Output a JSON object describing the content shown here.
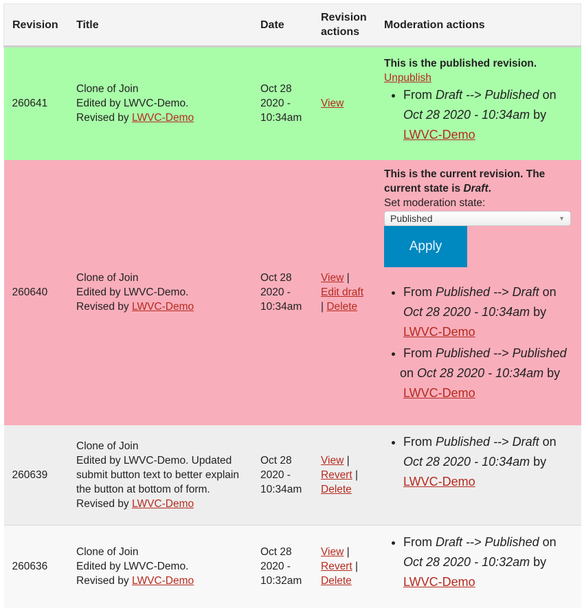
{
  "headers": {
    "revision": "Revision",
    "title": "Title",
    "date": "Date",
    "revision_actions": "Revision actions",
    "moderation_actions": "Moderation actions"
  },
  "colors": {
    "published_row": "#a9fda9",
    "current_row": "#f9aebb",
    "link": "#b52b1f",
    "apply_button": "#0088c0"
  },
  "rows": [
    {
      "revision": "260641",
      "title": "Clone of Join",
      "edited": "Edited by LWVC-Demo.",
      "revised_prefix": "Revised by ",
      "revised_user": "LWVC-Demo",
      "date": [
        "Oct 28",
        "2020 -",
        "10:34am"
      ],
      "actions": {
        "view": "View"
      },
      "moderation": {
        "status": "This is the published revision.",
        "unpublish": "Unpublish",
        "log": [
          {
            "from_word": "From ",
            "from": "Draft",
            "arrow": " --> ",
            "to": "Published",
            "on": " on ",
            "when": "Oct 28 2020 - 10:34am",
            "by": " by ",
            "user": "LWVC-Demo"
          }
        ]
      }
    },
    {
      "revision": "260640",
      "title": "Clone of Join",
      "edited": "Edited by LWVC-Demo.",
      "revised_prefix": "Revised by ",
      "revised_user": "LWVC-Demo",
      "date": [
        "Oct 28",
        "2020 -",
        "10:34am"
      ],
      "actions": {
        "view": "View",
        "edit_draft": "Edit draft",
        "delete": "Delete",
        "sep": " | "
      },
      "moderation": {
        "status_prefix": "This is the current revision. The current state is ",
        "status_state": "Draft",
        "status_suffix": ".",
        "set_label": "Set moderation state:",
        "select_value": "Published",
        "apply": "Apply",
        "log": [
          {
            "from_word": "From ",
            "from": "Published",
            "arrow": " --> ",
            "to": "Draft",
            "on": " on ",
            "when": "Oct 28 2020 - 10:34am",
            "by": " by ",
            "user": "LWVC-Demo"
          },
          {
            "from_word": "From ",
            "from": "Published",
            "arrow": " --> ",
            "to": "Published",
            "on": " on ",
            "when": "Oct 28 2020 - 10:34am",
            "by": " by ",
            "user": "LWVC-Demo"
          }
        ]
      }
    },
    {
      "revision": "260639",
      "title": "Clone of Join",
      "edited": "Edited by LWVC-Demo. Updated submit button text to better explain the button at bottom of form.",
      "revised_prefix": "Revised by ",
      "revised_user": "LWVC-Demo",
      "date": [
        "Oct 28",
        "2020 -",
        "10:34am"
      ],
      "actions": {
        "view": "View",
        "revert": "Revert",
        "delete": "Delete",
        "sep": " | "
      },
      "moderation": {
        "log": [
          {
            "from_word": "From ",
            "from": "Published",
            "arrow": " --> ",
            "to": "Draft",
            "on": " on ",
            "when": "Oct 28 2020 - 10:34am",
            "by": " by ",
            "user": "LWVC-Demo"
          }
        ]
      }
    },
    {
      "revision": "260636",
      "title": "Clone of Join",
      "edited": "Edited by LWVC-Demo.",
      "revised_prefix": "Revised by ",
      "revised_user": "LWVC-Demo",
      "date": [
        "Oct 28",
        "2020 -",
        "10:32am"
      ],
      "actions": {
        "view": "View",
        "revert": "Revert",
        "delete": "Delete",
        "sep": " | "
      },
      "moderation": {
        "log": [
          {
            "from_word": "From ",
            "from": "Draft",
            "arrow": " --> ",
            "to": "Published",
            "on": " on ",
            "when": "Oct 28 2020 - 10:32am",
            "by": " by ",
            "user": "LWVC-Demo"
          }
        ]
      }
    }
  ]
}
